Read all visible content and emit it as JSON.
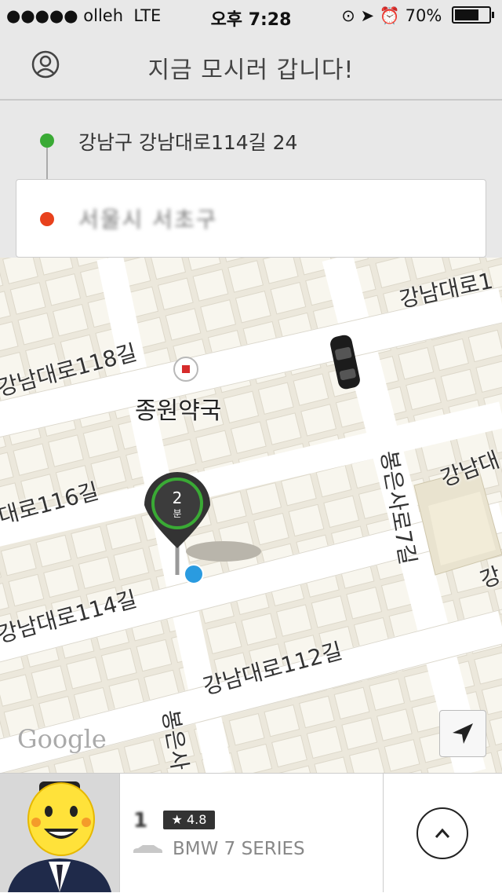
{
  "status_bar": {
    "carrier": "●●●●● olleh",
    "network": "LTE",
    "time": "오후 7:28",
    "battery": "70%"
  },
  "nav": {
    "title": "지금 모시러 갑니다!"
  },
  "route": {
    "pickup_address": "강남구 강남대로114길 24",
    "destination_address": "서울시 서초구"
  },
  "map": {
    "roads": {
      "top_right": "강남대로1",
      "r118": "강남대로118길",
      "r116": "대로116길",
      "r114": "강남대로114길",
      "r112": "강남대로112길",
      "right_mid": "강남대",
      "right_low": "강",
      "vertical": "봉은사로7길",
      "bottom_vert": "봉은사"
    },
    "poi": "종원약국",
    "eta_value": "2",
    "eta_unit": "분",
    "logo": "Google"
  },
  "driver": {
    "plate": "1",
    "rating": "4.8",
    "car_model": "BMW 7 SERIES"
  },
  "colors": {
    "pickup": "#3aaa35",
    "destination": "#e8411c",
    "current_location": "#2a9be0",
    "eta_ring": "#3aaa35"
  },
  "icons": {
    "profile": "person-icon",
    "locate": "navigation-arrow-icon",
    "expand": "chevron-up-icon",
    "car": "car-icon",
    "star": "star-icon"
  }
}
